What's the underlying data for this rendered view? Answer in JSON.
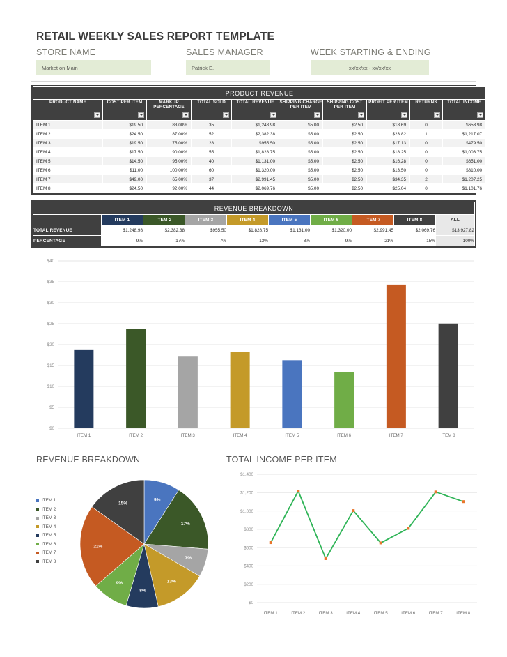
{
  "header": {
    "title": "RETAIL WEEKLY SALES REPORT TEMPLATE",
    "fields": [
      {
        "label": "STORE NAME",
        "value": "Market on Main",
        "align": "left"
      },
      {
        "label": "SALES MANAGER",
        "value": "Patrick E.",
        "align": "left"
      },
      {
        "label": "WEEK STARTING & ENDING",
        "value": "xx/xx/xx - xx/xx/xx",
        "align": "center"
      }
    ]
  },
  "product_revenue": {
    "banner": "PRODUCT REVENUE",
    "columns": [
      "PRODUCT NAME",
      "COST PER ITEM",
      "MARKUP PERCENTAGE",
      "TOTAL SOLD",
      "TOTAL REVENUE",
      "SHIPPING CHARGE PER ITEM",
      "SHIPPING COST PER ITEM",
      "PROFIT PER ITEM",
      "RETURNS",
      "TOTAL INCOME"
    ],
    "filter_icon": "filter-dropdown-icon",
    "rows": [
      [
        "ITEM 1",
        "$19.50",
        "83.00%",
        "35",
        "$1,248.98",
        "$5.00",
        "$2.50",
        "$18.69",
        "0",
        "$653.98"
      ],
      [
        "ITEM 2",
        "$24.50",
        "87.00%",
        "52",
        "$2,382.38",
        "$5.00",
        "$2.50",
        "$23.82",
        "1",
        "$1,217.07"
      ],
      [
        "ITEM 3",
        "$19.50",
        "75.00%",
        "28",
        "$955.50",
        "$5.00",
        "$2.50",
        "$17.13",
        "0",
        "$479.50"
      ],
      [
        "ITEM 4",
        "$17.50",
        "90.00%",
        "55",
        "$1,828.75",
        "$5.00",
        "$2.50",
        "$18.25",
        "0",
        "$1,003.75"
      ],
      [
        "ITEM 5",
        "$14.50",
        "95.00%",
        "40",
        "$1,131.00",
        "$5.00",
        "$2.50",
        "$16.28",
        "0",
        "$651.00"
      ],
      [
        "ITEM 6",
        "$11.00",
        "100.00%",
        "60",
        "$1,320.00",
        "$5.00",
        "$2.50",
        "$13.50",
        "0",
        "$810.00"
      ],
      [
        "ITEM 7",
        "$49.00",
        "65.00%",
        "37",
        "$2,991.45",
        "$5.00",
        "$2.50",
        "$34.35",
        "2",
        "$1,207.25"
      ],
      [
        "ITEM 8",
        "$24.50",
        "92.00%",
        "44",
        "$2,069.76",
        "$5.00",
        "$2.50",
        "$25.04",
        "0",
        "$1,101.76"
      ]
    ]
  },
  "revenue_breakdown_table": {
    "banner": "REVENUE BREAKDOWN",
    "item_headers": [
      "ITEM 1",
      "ITEM 2",
      "ITEM 3",
      "ITEM 4",
      "ITEM 5",
      "ITEM 6",
      "ITEM 7",
      "ITEM 8"
    ],
    "all_header": "ALL",
    "rows": [
      {
        "label": "TOTAL REVENUE",
        "values": [
          "$1,248.98",
          "$2,382.38",
          "$955.50",
          "$1,828.75",
          "$1,131.00",
          "$1,320.00",
          "$2,991.45",
          "$2,069.76"
        ],
        "total": "$13,927.82"
      },
      {
        "label": "PERCENTAGE",
        "values": [
          "9%",
          "17%",
          "7%",
          "13%",
          "8%",
          "9%",
          "21%",
          "15%"
        ],
        "total": "100%"
      }
    ]
  },
  "colors": {
    "item_series": [
      "#243b5e",
      "#3b5828",
      "#a5a5a5",
      "#c49a29",
      "#4a75bf",
      "#70ad47",
      "#c55a22",
      "#404040"
    ],
    "header_dark": "#404040",
    "field_green": "#e3ecd6",
    "line_stroke": "#2fb457",
    "line_marker": "#e8762c"
  },
  "chart_data": [
    {
      "type": "bar",
      "name": "profit-per-item-bar-chart",
      "title": "",
      "categories": [
        "ITEM 1",
        "ITEM 2",
        "ITEM 3",
        "ITEM 4",
        "ITEM 5",
        "ITEM 6",
        "ITEM 7",
        "ITEM 8"
      ],
      "values": [
        18.69,
        23.82,
        17.13,
        18.25,
        16.28,
        13.5,
        34.35,
        25.04
      ],
      "ylabel": "",
      "xlabel": "",
      "ylim": [
        0,
        40
      ],
      "ytick_labels": [
        "$0",
        "$5",
        "$10",
        "$15",
        "$20",
        "$25",
        "$30",
        "$35",
        "$40"
      ],
      "ytick_values": [
        0,
        5,
        10,
        15,
        20,
        25,
        30,
        35,
        40
      ],
      "grid": true,
      "legend": "none",
      "bar_colors": [
        "#243b5e",
        "#3b5828",
        "#a5a5a5",
        "#c49a29",
        "#4a75bf",
        "#70ad47",
        "#c55a22",
        "#404040"
      ]
    },
    {
      "type": "pie",
      "name": "revenue-breakdown-pie-chart",
      "title": "REVENUE BREAKDOWN",
      "labels": [
        "ITEM 1",
        "ITEM 2",
        "ITEM 3",
        "ITEM 4",
        "ITEM 5",
        "ITEM 6",
        "ITEM 7",
        "ITEM 8"
      ],
      "values": [
        9,
        17,
        7,
        13,
        8,
        9,
        21,
        15
      ],
      "value_labels": [
        "9%",
        "17%",
        "7%",
        "13%",
        "8%",
        "9%",
        "21%",
        "15%"
      ],
      "slice_colors": [
        "#4a75bf",
        "#3b5828",
        "#a5a5a5",
        "#c49a29",
        "#243b5e",
        "#70ad47",
        "#c55a22",
        "#404040"
      ],
      "legend_colors": [
        "#4a75bf",
        "#3b5828",
        "#a5a5a5",
        "#c49a29",
        "#243b5e",
        "#70ad47",
        "#c55a22",
        "#404040"
      ],
      "legend": "left"
    },
    {
      "type": "line",
      "name": "total-income-per-item-line-chart",
      "title": "TOTAL INCOME PER ITEM",
      "categories": [
        "ITEM 1",
        "ITEM 2",
        "ITEM 3",
        "ITEM 4",
        "ITEM 5",
        "ITEM 6",
        "ITEM 7",
        "ITEM 8"
      ],
      "values": [
        653.98,
        1217.07,
        479.5,
        1003.75,
        651.0,
        810.0,
        1207.25,
        1101.76
      ],
      "ylim": [
        0,
        1400
      ],
      "ytick_labels": [
        "$0",
        "$200",
        "$400",
        "$600",
        "$800",
        "$1,000",
        "$1,200",
        "$1,400"
      ],
      "ytick_values": [
        0,
        200,
        400,
        600,
        800,
        1000,
        1200,
        1400
      ],
      "grid": true,
      "legend": "none",
      "line_color": "#2fb457",
      "marker_color": "#e8762c"
    }
  ]
}
